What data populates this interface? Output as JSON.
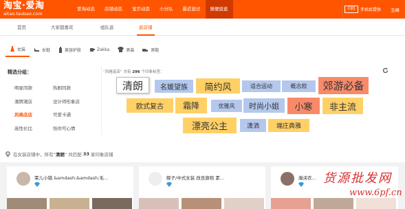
{
  "brand": {
    "logo_title": "淘宝·爱淘",
    "logo_url": "aitao.taobao.com",
    "color": "#ff5500"
  },
  "nav": {
    "items": [
      "爱淘动态",
      "店铺动态",
      "宝贝动态",
      "小分队",
      "最近逛过",
      "随便逛逛"
    ],
    "active": "随便逛逛"
  },
  "right": {
    "qr_label": "扫码",
    "mobile": "手机给提供",
    "user": "玉峰"
  },
  "subnav": {
    "items": [
      "首页",
      "大家都喜欢",
      "组队逛",
      "逛店铺"
    ],
    "active": "逛店铺"
  },
  "categories": [
    {
      "label": "女装",
      "icon": "dress-icon",
      "active": true
    },
    {
      "label": "女鞋",
      "icon": "shoe-icon"
    },
    {
      "label": "美容护肤",
      "icon": "bottle-icon"
    },
    {
      "label": "Zakka",
      "icon": "cup-icon"
    },
    {
      "label": "男装",
      "icon": "shirt-icon"
    },
    {
      "label": "男鞋",
      "icon": "mens-shoe-icon"
    }
  ],
  "styles": {
    "title": "精选分组：",
    "items": [
      "明星同款",
      "热剧同款",
      "潮牌潮店",
      "设计师形象店",
      "风格店店",
      "可爱卡通",
      "高性价比",
      "恰你可心情"
    ],
    "active": "风格店店"
  },
  "hint": {
    "prefix": "“风格逛店” 共有",
    "count": "296",
    "suffix": "个印象标签："
  },
  "tags": [
    {
      "label": "清朗",
      "color": "#ffffff",
      "selected": true
    },
    {
      "label": "名媛望族",
      "color": "#b4c8ee"
    },
    {
      "label": "简约风",
      "color": "#ffd066"
    },
    {
      "label": "适合运动",
      "color": "#b4c8ee"
    },
    {
      "label": "概念款",
      "color": "#b4c8ee"
    },
    {
      "label": "郊游必备",
      "color": "#f88a6a"
    },
    {
      "label": "欧式复古",
      "color": "#ffd066"
    },
    {
      "label": "霜降",
      "color": "#ffd066"
    },
    {
      "label": "优雅风",
      "color": "#b4c8ee"
    },
    {
      "label": "时尚小姐",
      "color": "#b4c8ee"
    },
    {
      "label": "小寒",
      "color": "#f88a6a"
    },
    {
      "label": "非主流",
      "color": "#ffd066"
    },
    {
      "label": "漂亮公主",
      "color": "#ffd066"
    },
    {
      "label": "潇洒",
      "color": "#b4c8ee"
    },
    {
      "label": "端庄典雅",
      "color": "#ffd066"
    }
  ],
  "status": {
    "p1": "在女装店铺中，所有“",
    "keyword": "清朗",
    "p2": "” 共匹配",
    "count": "33",
    "p3": "家印象店铺"
  },
  "shops": [
    {
      "name": "茉儿小铺 &amdash;&amdash;毛…"
    },
    {
      "name": "鲸子/中式女装 改良旗袍 素…"
    },
    {
      "name": "瀚泱衣…"
    }
  ],
  "watermark": {
    "line1": "货源批发网",
    "line2": "www.6pf.cn"
  }
}
